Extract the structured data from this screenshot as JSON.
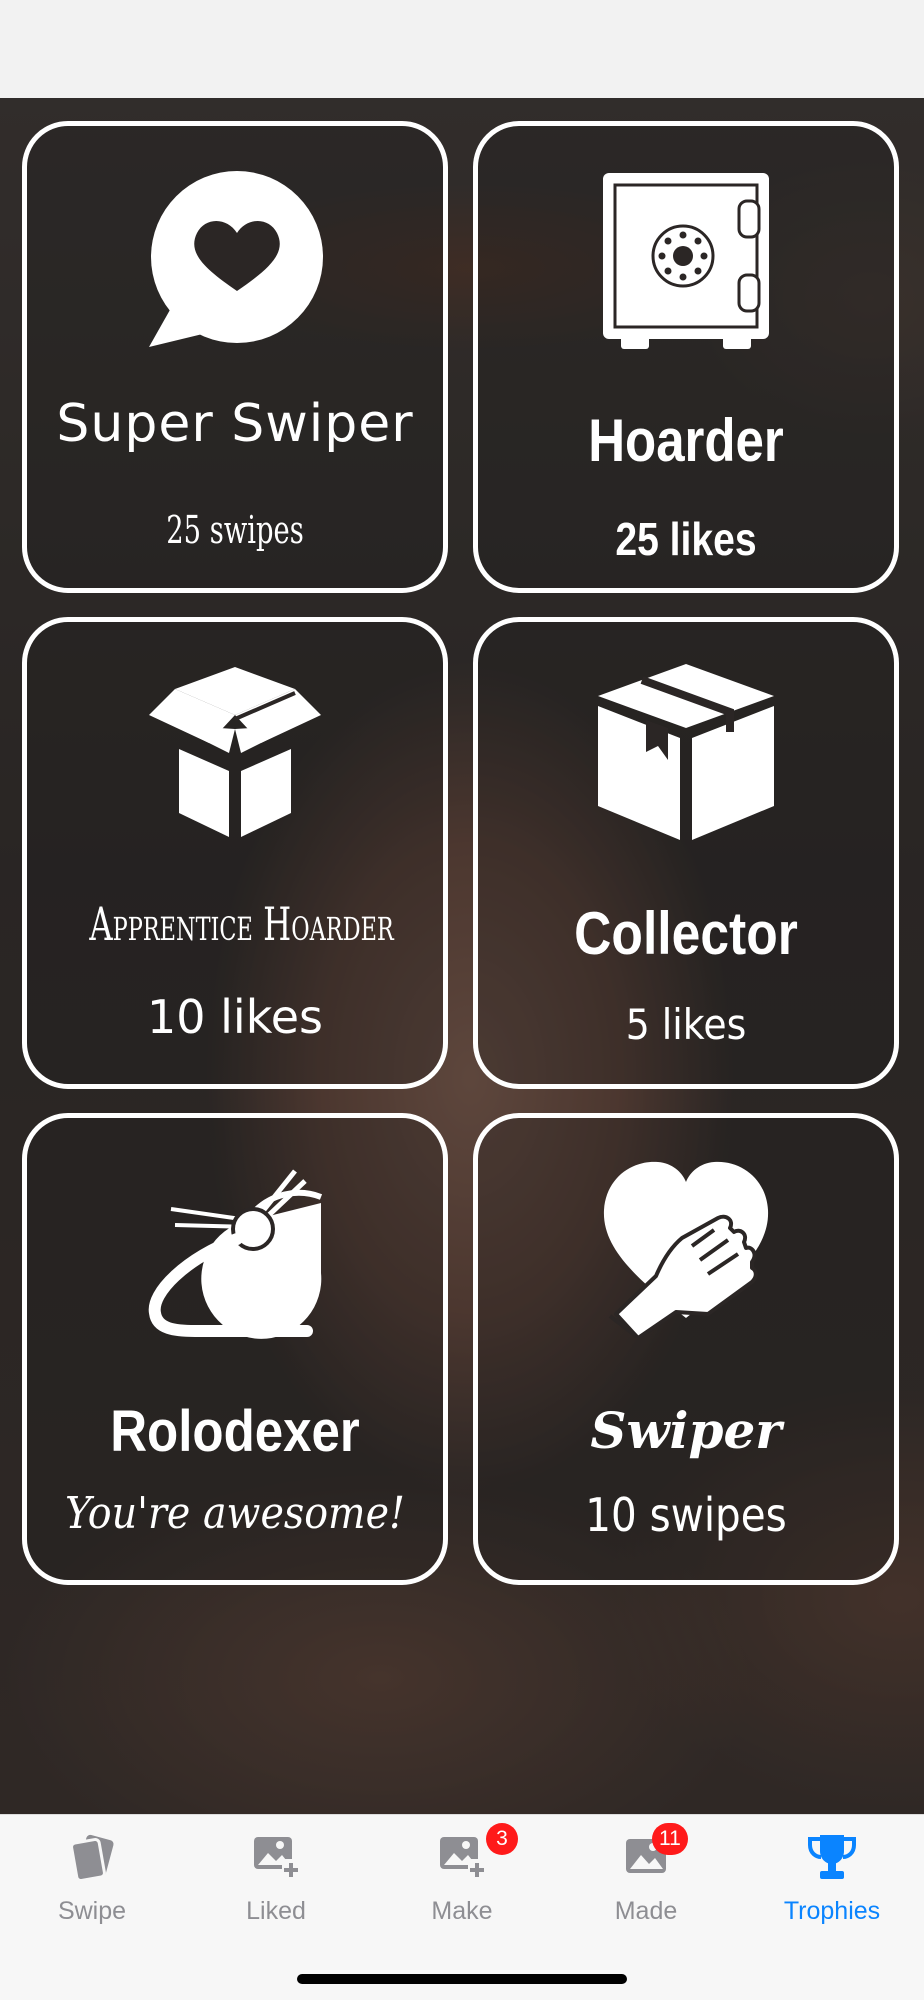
{
  "trophies": [
    {
      "title": "Super Swiper",
      "subtitle": "25 swipes",
      "icon": "speech-bubble-heart-icon"
    },
    {
      "title": "Hoarder",
      "subtitle": "25 likes",
      "icon": "safe-icon"
    },
    {
      "title": "Apprentice Hoarder",
      "subtitle": "10 likes",
      "icon": "open-box-icon"
    },
    {
      "title": "Collector",
      "subtitle": "5 likes",
      "icon": "closed-box-icon"
    },
    {
      "title": "Rolodexer",
      "subtitle": "You're awesome!",
      "icon": "satellite-dish-icon"
    },
    {
      "title": "Swiper",
      "subtitle": "10 swipes",
      "icon": "hand-heart-icon"
    }
  ],
  "tabbar": {
    "tabs": [
      {
        "label": "Swipe",
        "icon": "cards-icon",
        "badge": null,
        "active": false
      },
      {
        "label": "Liked",
        "icon": "image-plus-icon",
        "badge": null,
        "active": false
      },
      {
        "label": "Make",
        "icon": "image-plus-icon",
        "badge": "3",
        "active": false
      },
      {
        "label": "Made",
        "icon": "image-icon",
        "badge": "11",
        "active": false
      },
      {
        "label": "Trophies",
        "icon": "trophy-icon",
        "badge": null,
        "active": true
      }
    ]
  },
  "colors": {
    "active_tab": "#0a84ff",
    "inactive_tab": "#8e8e93",
    "badge": "#ff1a1a",
    "card_border": "#ffffff"
  }
}
